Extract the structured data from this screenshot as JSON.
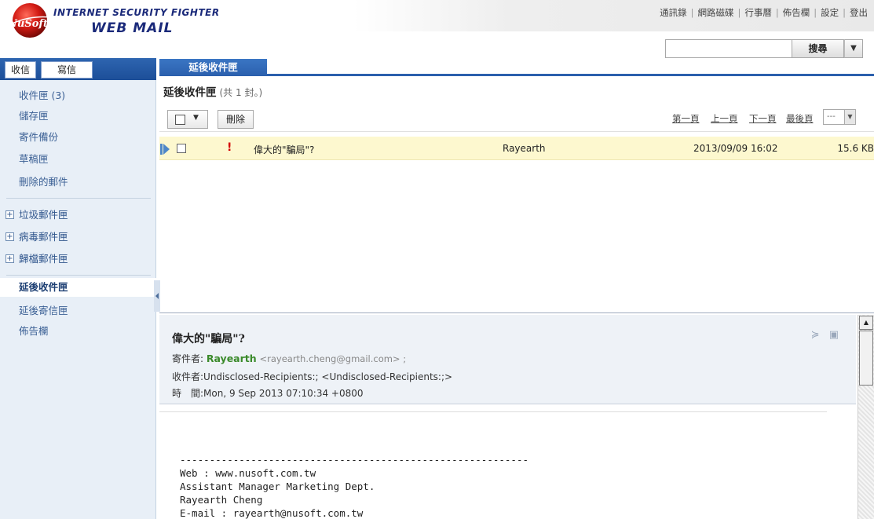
{
  "header": {
    "logo_text": "NuSoft",
    "title_line1": "INTERNET SECURITY FIGHTER",
    "title_line2": "WEB MAIL",
    "top_links": [
      "通訊錄",
      "網路磁碟",
      "行事曆",
      "佈告欄",
      "設定",
      "登出"
    ],
    "search": {
      "value": "",
      "button_label": "搜尋"
    }
  },
  "sidebar": {
    "tabs": {
      "receive": "收信",
      "write": "寫信"
    },
    "folders": [
      {
        "label": "收件匣 (3)"
      },
      {
        "label": "儲存匣"
      },
      {
        "label": "寄件備份"
      },
      {
        "label": "草稿匣"
      },
      {
        "label": "刪除的郵件"
      }
    ],
    "expandable": [
      {
        "label": "垃圾郵件匣"
      },
      {
        "label": "病毒郵件匣"
      },
      {
        "label": "歸檔郵件匣"
      }
    ],
    "special": [
      {
        "label": "延後收件匣",
        "active": true
      },
      {
        "label": "延後寄信匣"
      },
      {
        "label": "佈告欄"
      }
    ]
  },
  "content": {
    "tab_label": "延後收件匣",
    "title": "延後收件匣",
    "count_text": "(共 1 封。)",
    "toolbar": {
      "delete_label": "刪除"
    },
    "pager": {
      "first": "第一頁",
      "prev": "上一頁",
      "next": "下一頁",
      "last": "最後頁",
      "page_select": "---"
    },
    "messages": [
      {
        "subject": "偉大的\"騙局\"?",
        "from": "Rayearth",
        "date": "2013/09/09 16:02",
        "size": "15.6 KB",
        "priority": "!"
      }
    ]
  },
  "reader": {
    "subject": "偉大的\"騙局\"?",
    "from_label": "寄件者:",
    "from_name": "Rayearth",
    "from_email": "<rayearth.cheng@gmail.com> ;",
    "to_label": "收件者:",
    "to_value": "Undisclosed-Recipients:; <Undisclosed-Recipients:;>",
    "time_label": "時　間:",
    "time_value": "Mon, 9 Sep 2013 07:10:34 +0800",
    "body_lines": [
      "-----------------------------------------------------------",
      "Web : www.nusoft.com.tw",
      "Assistant Manager Marketing Dept.",
      "Rayearth Cheng",
      "E-mail : rayearth@nusoft.com.tw"
    ]
  },
  "colors": {
    "header_blue": "#2b60ad",
    "sidebar_bg": "#e8eff7",
    "row_highlight": "#fdf8cf",
    "sender_green": "#3a8a2a",
    "priority_red": "#d40000"
  }
}
